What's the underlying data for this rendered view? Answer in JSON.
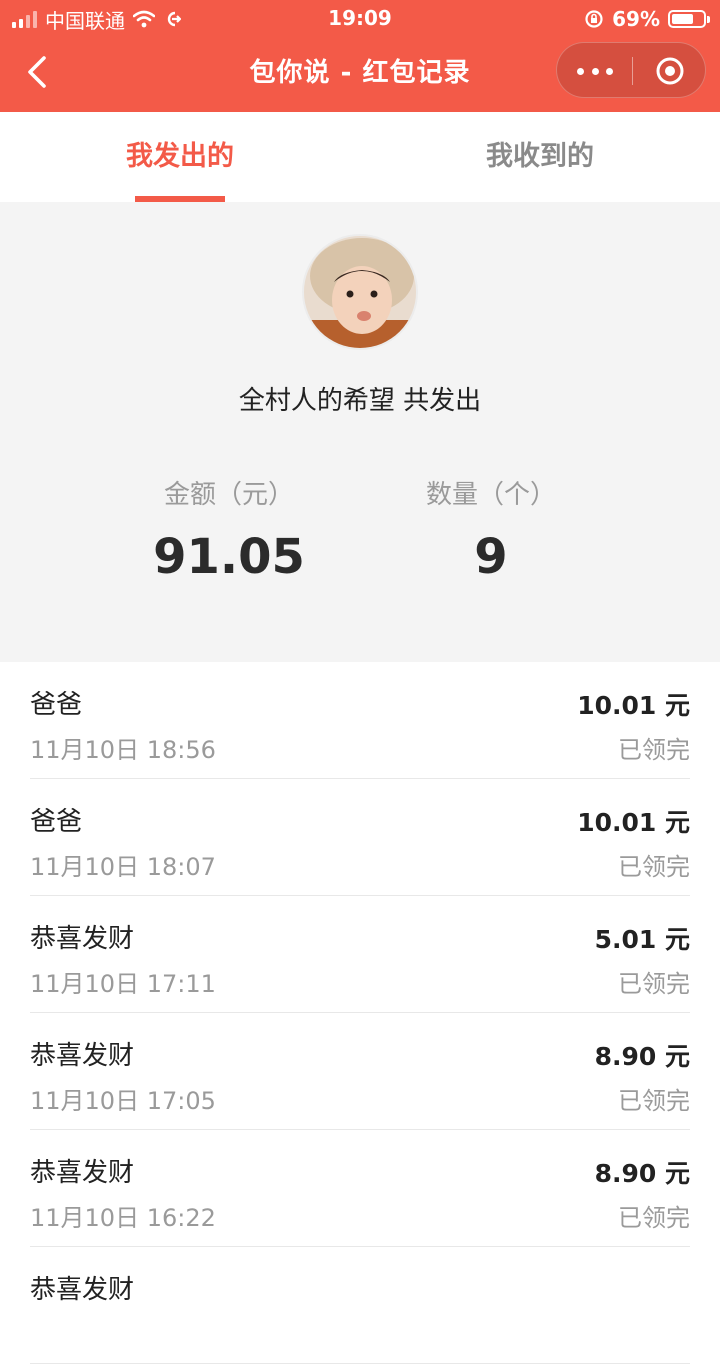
{
  "status_bar": {
    "carrier": "中国联通",
    "time": "19:09",
    "battery": "69%"
  },
  "nav": {
    "title": "包你说 - 红包记录"
  },
  "tabs": [
    {
      "label": "我发出的",
      "active": true
    },
    {
      "label": "我收到的",
      "active": false
    }
  ],
  "summary": {
    "sender_line": "全村人的希望 共发出",
    "amount_label": "金额（元）",
    "amount_value": "91.05",
    "count_label": "数量（个）",
    "count_value": "9"
  },
  "records": [
    {
      "name": "爸爸",
      "time": "11月10日 18:56",
      "amount": "10.01 元",
      "status": "已领完"
    },
    {
      "name": "爸爸",
      "time": "11月10日 18:07",
      "amount": "10.01 元",
      "status": "已领完"
    },
    {
      "name": "恭喜发财",
      "time": "11月10日 17:11",
      "amount": "5.01 元",
      "status": "已领完"
    },
    {
      "name": "恭喜发财",
      "time": "11月10日 17:05",
      "amount": "8.90 元",
      "status": "已领完"
    },
    {
      "name": "恭喜发财",
      "time": "11月10日 16:22",
      "amount": "8.90 元",
      "status": "已领完"
    },
    {
      "name": "恭喜发财",
      "time": "",
      "amount": "",
      "status": ""
    }
  ],
  "colors": {
    "brand": "#f35a48",
    "muted": "#9a9a9a",
    "panel": "#f4f4f4"
  },
  "icons": [
    "back-arrow-icon",
    "more-dots-icon",
    "close-target-icon",
    "wifi-icon",
    "apple-icon",
    "battery-icon"
  ]
}
